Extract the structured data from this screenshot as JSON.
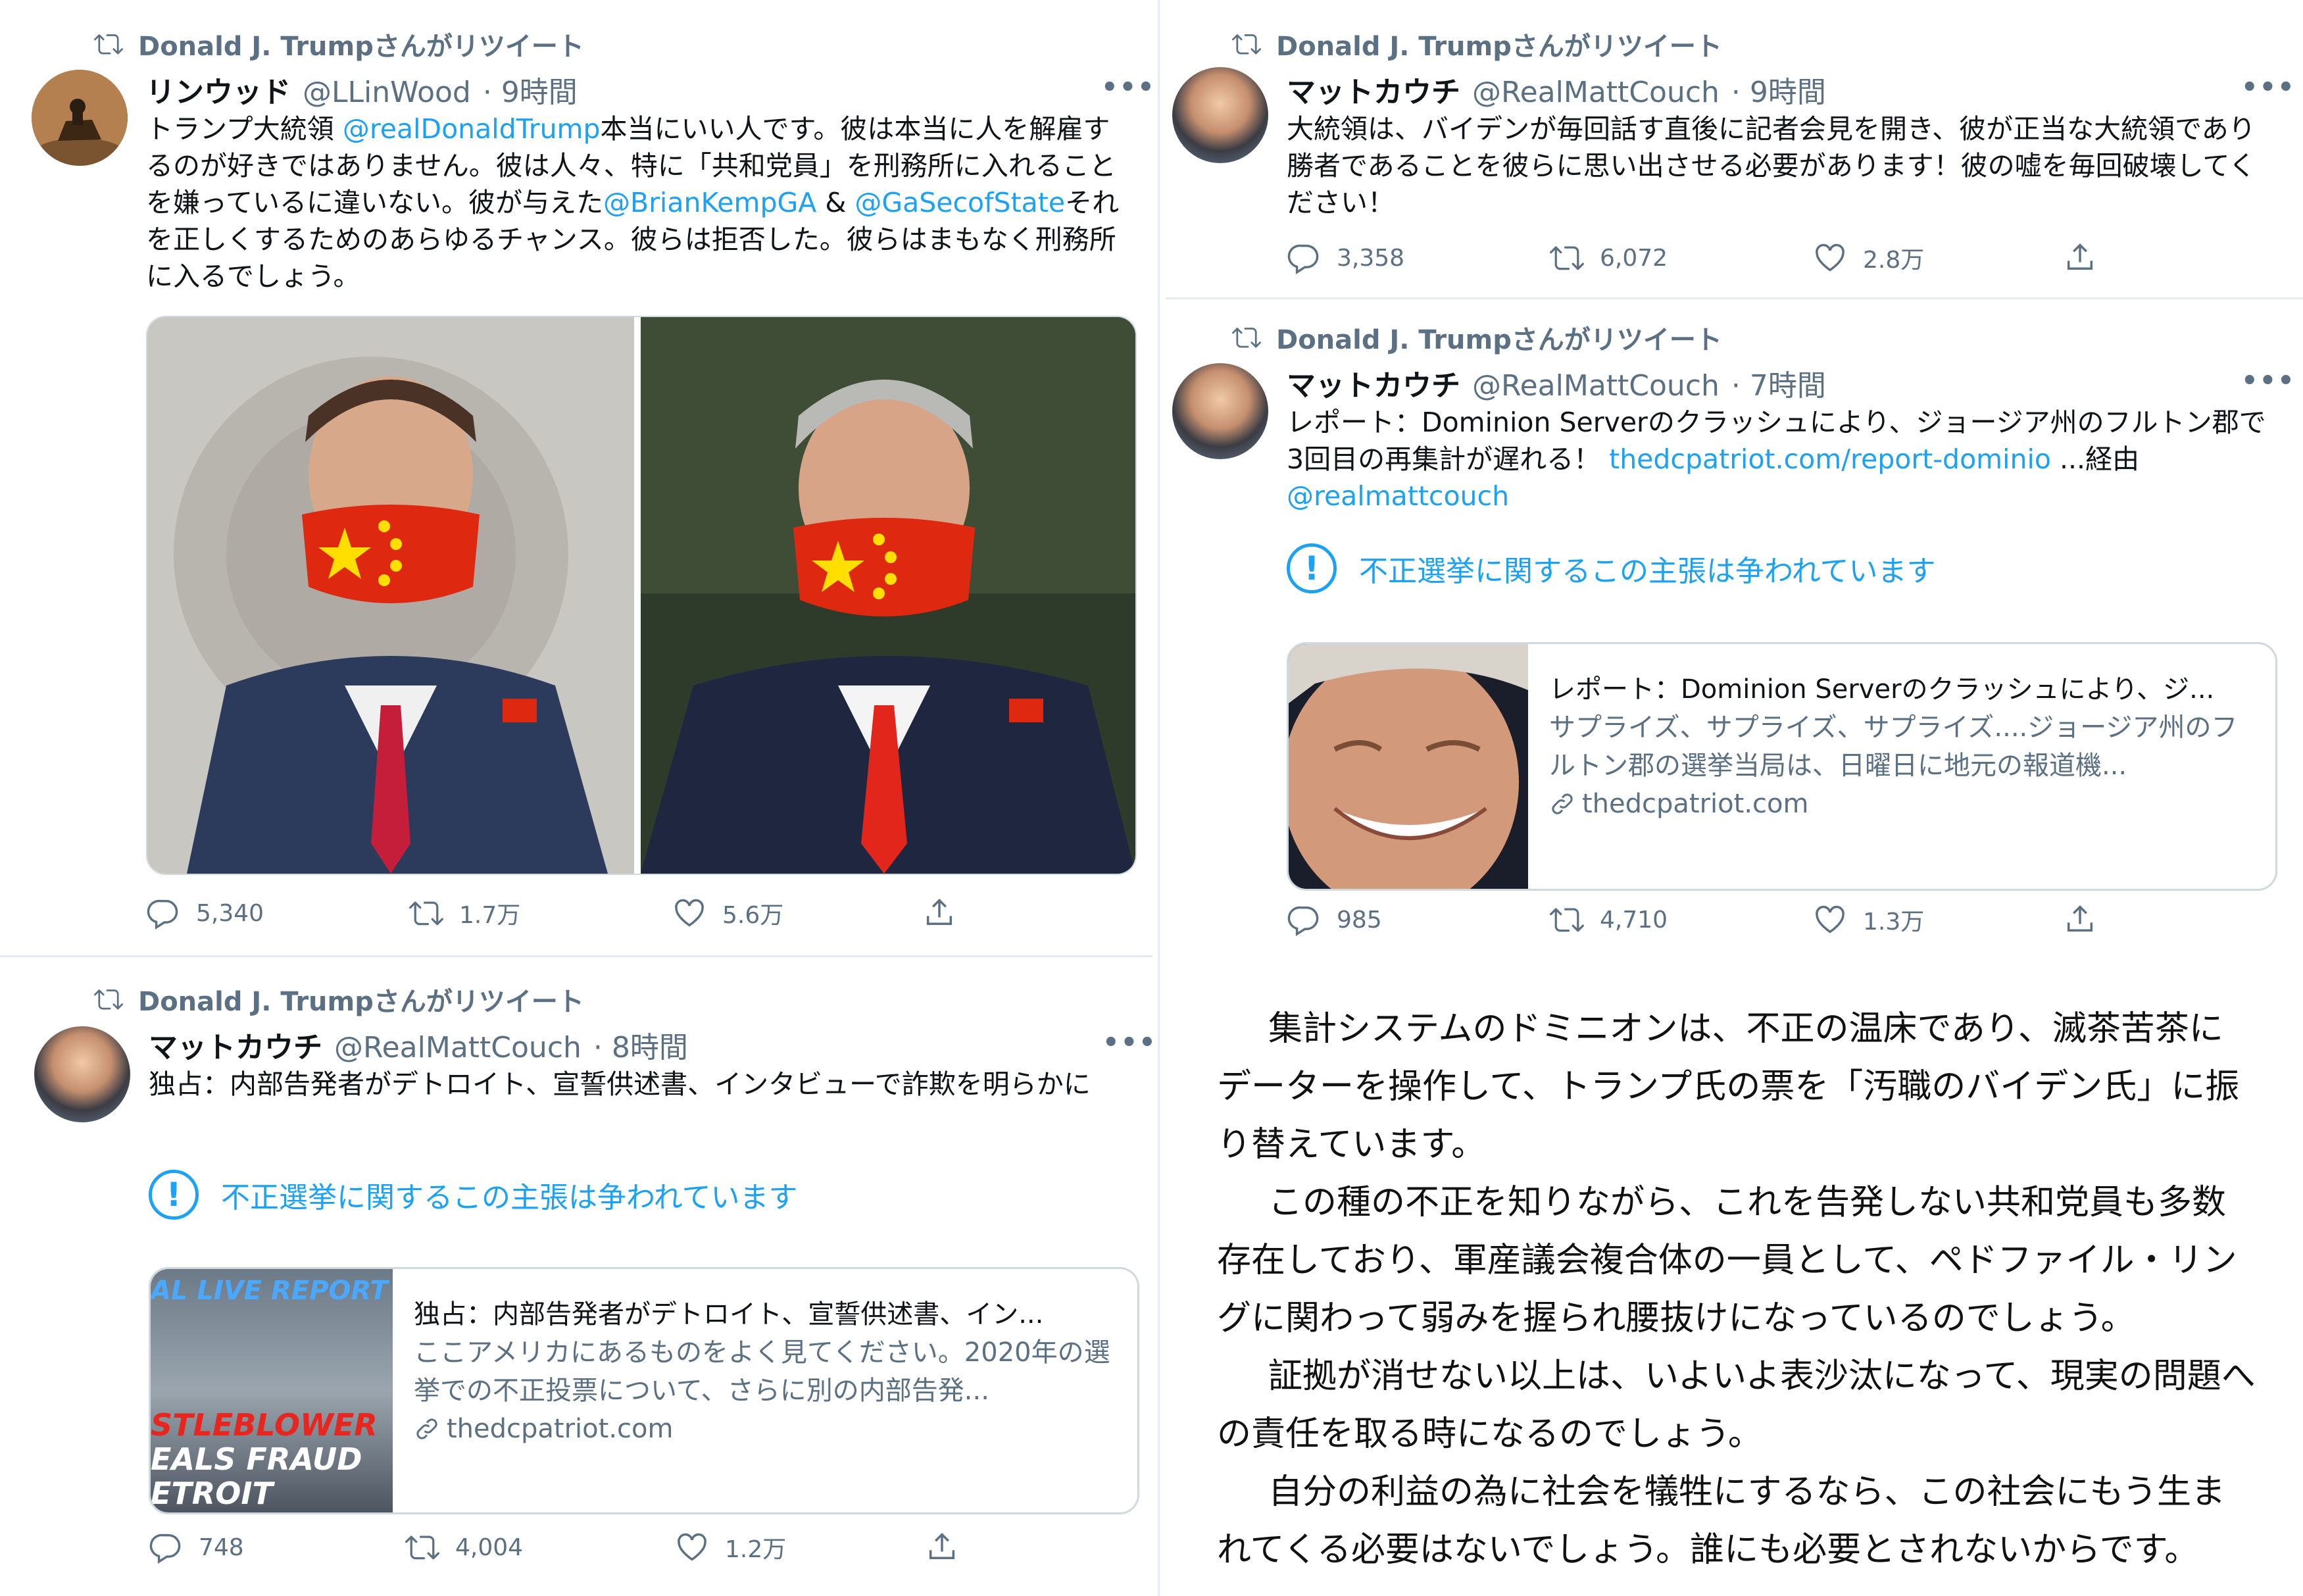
{
  "retweet_label": "Donald J. Trumpさんがリツイート",
  "tweets": [
    {
      "name": "リンウッド",
      "handle": "@LLinWood",
      "time": "· 9時間",
      "more": "•••",
      "text_parts": [
        "トランプ大統領 ",
        "@realDonaldTrump",
        "本当にいい人です。彼は本当に人を解雇するのが好きではありません。彼は人々、特に「共和党員」を刑務所に入れることを嫌っているに違いない。彼が与えた",
        "@BrianKempGA",
        " & ",
        "@GaSecofState",
        "それを正しくするためのあらゆるチャンス。彼らは拒否した。彼らはまもなく刑務所に入るでしょう。"
      ],
      "replies": "5,340",
      "retweets": "1.7万",
      "likes": "5.6万"
    },
    {
      "name": "マットカウチ",
      "handle": "@RealMattCouch",
      "time": "· 9時間",
      "more": "•••",
      "text": "大統領は、バイデンが毎回話す直後に記者会見を開き、彼が正当な大統領であり勝者であることを彼らに思い出させる必要があります！彼の嘘を毎回破壊してください！",
      "replies": "3,358",
      "retweets": "6,072",
      "likes": "2.8万"
    },
    {
      "name": "マットカウチ",
      "handle": "@RealMattCouch",
      "time": "· 7時間",
      "more": "•••",
      "text_parts": [
        "レポート：Dominion Serverのクラッシュにより、ジョージア州のフルトン郡で3回目の再集計が遅れる！ ",
        "thedcpatriot.com/report-dominio",
        " ...経由",
        "@realmattcouch"
      ],
      "notice": "不正選挙に関するこの主張は争われています",
      "card": {
        "title": "レポート：Dominion Serverのクラッシュにより、ジ...",
        "description": "サプライズ、サプライズ、サプライズ....ジョージア州のフルトン郡の選挙当局は、日曜日に地元の報道機...",
        "domain": "thedcpatriot.com"
      },
      "replies": "985",
      "retweets": "4,710",
      "likes": "1.3万"
    },
    {
      "name": "マットカウチ",
      "handle": "@RealMattCouch",
      "time": "· 8時間",
      "more": "•••",
      "text": "独占：内部告発者がデトロイト、宣誓供述書、インタビューで詐欺を明らかに",
      "notice": "不正選挙に関するこの主張は争われています",
      "card": {
        "title": "独占：内部告発者がデトロイト、宣誓供述書、イン...",
        "description": "ここアメリカにあるものをよく見てください。2020年の選挙での不正投票について、さらに別の内部告発...",
        "domain": "thedcpatriot.com",
        "thumb_text": [
          "AL LIVE REPORT",
          "STLEBLOWER",
          "EALS FRAUD",
          "ETROIT"
        ]
      },
      "replies": "748",
      "retweets": "4,004",
      "likes": "1.2万"
    }
  ],
  "commentary": [
    "集計システムのドミニオンは、不正の温床であり、滅茶苦茶にデーターを操作して、トランプ氏の票を「汚職のバイデン氏」に振り替えています。",
    "この種の不正を知りながら、これを告発しない共和党員も多数存在しており、軍産議会複合体の一員として、ペドファイル・リングに関わって弱みを握られ腰抜けになっているのでしょう。",
    "証拠が消せない以上は、いよいよ表沙汰になって、現実の問題への責任を取る時になるのでしょう。",
    "自分の利益の為に社会を犠牲にするなら、この社会にもう生まれてくる必要はないでしょう。誰にも必要とされないからです。"
  ],
  "colors": {
    "link": "#1da1f2",
    "muted": "#5b7083",
    "text": "#0f1419",
    "border": "#cfd9de"
  }
}
